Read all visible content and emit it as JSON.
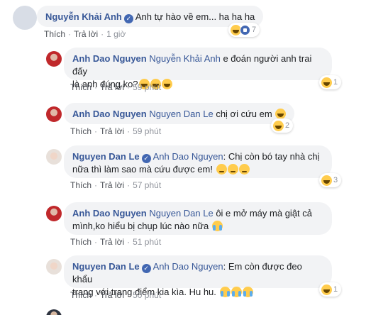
{
  "comments": [
    {
      "author": "Nguyễn Khải Anh",
      "text": "Anh tự hào về em... ha ha ha",
      "actions": {
        "like": "Thích",
        "reply": "Trả lời",
        "time": "1 giờ"
      },
      "reactions": {
        "count": "7"
      }
    },
    {
      "author": "Anh Dao Nguyen",
      "tag": "Nguyễn Khải Anh",
      "text_line1": " e đoán người anh trai đấy",
      "text_line2": "là anh đúng ko?",
      "actions": {
        "like": "Thích",
        "reply": "Trả lời",
        "time": "59 phút"
      },
      "reactions": {
        "count": "1"
      }
    },
    {
      "author": "Anh Dao Nguyen",
      "tag": "Nguyen Dan Le",
      "text": " chị ơi cứu em ",
      "actions": {
        "like": "Thích",
        "reply": "Trả lời",
        "time": "59 phút"
      },
      "reactions": {
        "count": "2"
      }
    },
    {
      "author": "Nguyen Dan Le",
      "tag": "Anh Dao Nguyen",
      "text_line1": ": Chị còn bó tay nhà chị",
      "text_line2": "nữa thì làm sao mà cứu được em! ",
      "actions": {
        "like": "Thích",
        "reply": "Trả lời",
        "time": "57 phút"
      },
      "reactions": {
        "count": "3"
      }
    },
    {
      "author": "Anh Dao Nguyen",
      "tag": "Nguyen Dan Le",
      "text_line1": " ôi e mở máy mà giật cả",
      "text_line2": "mình,ko hiểu bị chụp lúc nào nữa ",
      "actions": {
        "like": "Thích",
        "reply": "Trả lời",
        "time": "51 phút"
      }
    },
    {
      "author": "Nguyen Dan Le",
      "tag": "Anh Dao Nguyen",
      "text_line1": ": Em còn được đeo khẩu",
      "text_line2": "trang với trang điểm kia kìa. Hu hu. ",
      "actions": {
        "like": "Thích",
        "reply": "Trả lời",
        "time": "50 phút"
      },
      "reactions": {
        "count": "1"
      }
    }
  ],
  "colors": {
    "name": "#385898",
    "bubble": "#f2f3f5",
    "meta": "#90949c"
  },
  "icons": [
    "laugh-emoji-icon",
    "like-icon",
    "verified-badge-icon",
    "pensive-emoji-icon",
    "crying-emoji-icon"
  ]
}
